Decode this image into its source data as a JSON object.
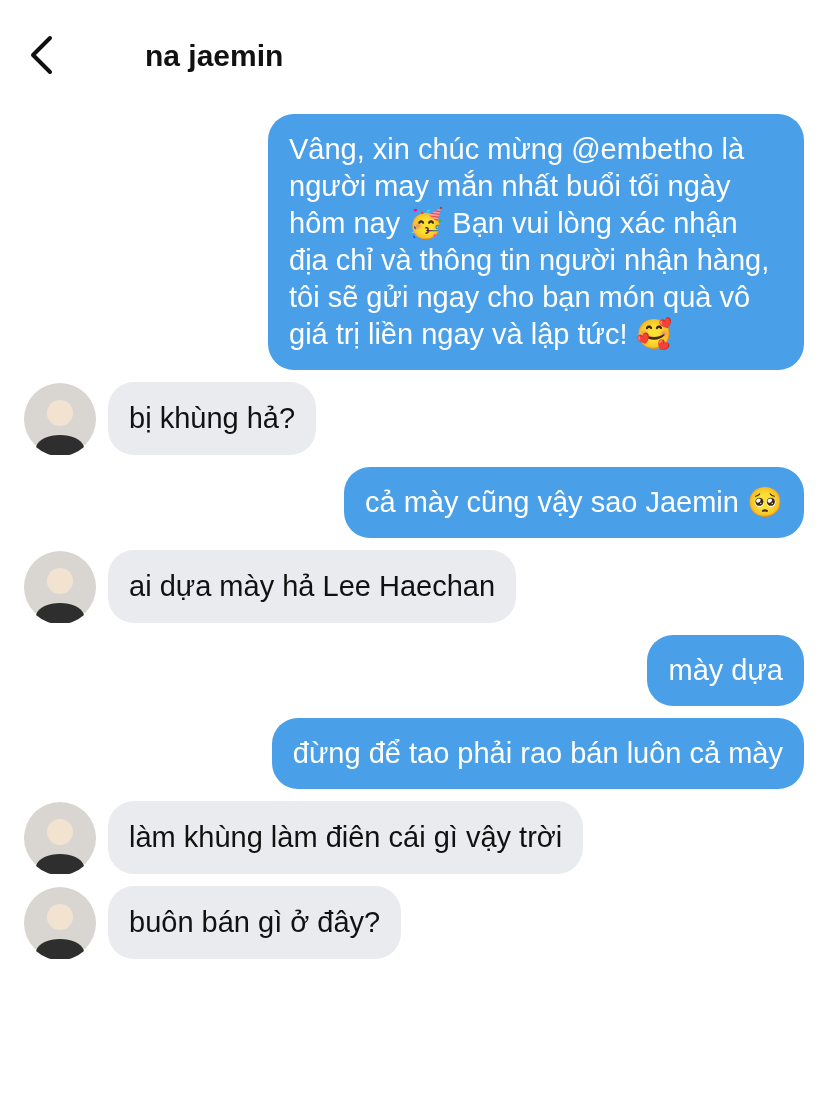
{
  "header": {
    "title": "na jaemin"
  },
  "messages": [
    {
      "kind": "outgoing",
      "text": "Vâng, xin chúc mừng @embetho là người may mắn nhất buổi tối ngày hôm nay 🥳 Bạn vui lòng xác nhận địa chỉ và thông tin người nhận hàng, tôi sẽ gửi ngay cho bạn món quà vô giá trị liền ngay và lập tức! 🥰"
    },
    {
      "kind": "incoming",
      "text": "bị khùng hả?"
    },
    {
      "kind": "outgoing",
      "text": "cả mày cũng vậy sao Jaemin 🥺"
    },
    {
      "kind": "incoming",
      "text": "ai dựa mày hả Lee Haechan"
    },
    {
      "kind": "outgoing",
      "text": "mày dựa"
    },
    {
      "kind": "outgoing",
      "text": "đừng để tao phải rao bán luôn cả mày"
    },
    {
      "kind": "incoming",
      "text": "làm khùng làm điên cái gì vậy trời"
    },
    {
      "kind": "incoming",
      "text": "buôn bán gì ở đây?"
    }
  ]
}
